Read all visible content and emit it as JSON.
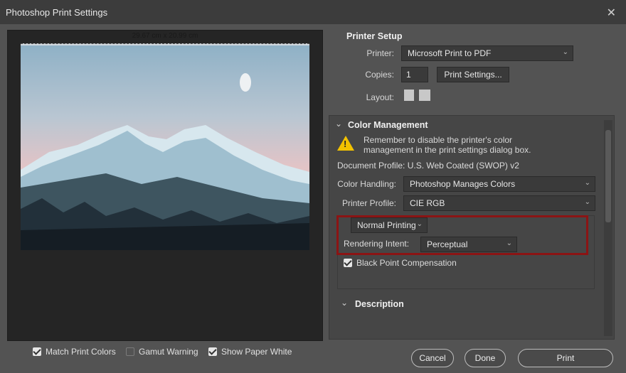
{
  "window": {
    "title": "Photoshop Print Settings",
    "close_glyph": "✕"
  },
  "preview": {
    "dimensions": "29.67 cm x 20.99 cm"
  },
  "printer_setup": {
    "header": "Printer Setup",
    "printer_label": "Printer:",
    "printer_value": "Microsoft Print to PDF",
    "copies_label": "Copies:",
    "copies_value": "1",
    "print_settings_button": "Print Settings...",
    "layout_label": "Layout:"
  },
  "color_management": {
    "header": "Color Management",
    "warning_line1": "Remember to disable the printer's color",
    "warning_line2": "management in the print settings dialog box.",
    "document_profile": "Document Profile: U.S. Web Coated (SWOP) v2",
    "color_handling_label": "Color Handling:",
    "color_handling_value": "Photoshop Manages Colors",
    "printer_profile_label": "Printer Profile:",
    "printer_profile_value": "CIE RGB",
    "normal_printing": "Normal Printing",
    "rendering_intent_label": "Rendering Intent:",
    "rendering_intent_value": "Perceptual",
    "black_point_label": "Black Point Compensation",
    "black_point_checked": true
  },
  "description": {
    "header": "Description"
  },
  "footer": {
    "match_print_colors": "Match Print Colors",
    "gamut_warning": "Gamut Warning",
    "show_paper_white": "Show Paper White",
    "cancel": "Cancel",
    "done": "Done",
    "print": "Print"
  },
  "colors": {
    "highlight_box": "#8b1414",
    "warning": "#f2c200"
  },
  "icons": [
    "close-icon",
    "chevron-down-icon",
    "warning-icon",
    "portrait-layout-icon",
    "landscape-layout-icon",
    "checkbox-icon"
  ]
}
